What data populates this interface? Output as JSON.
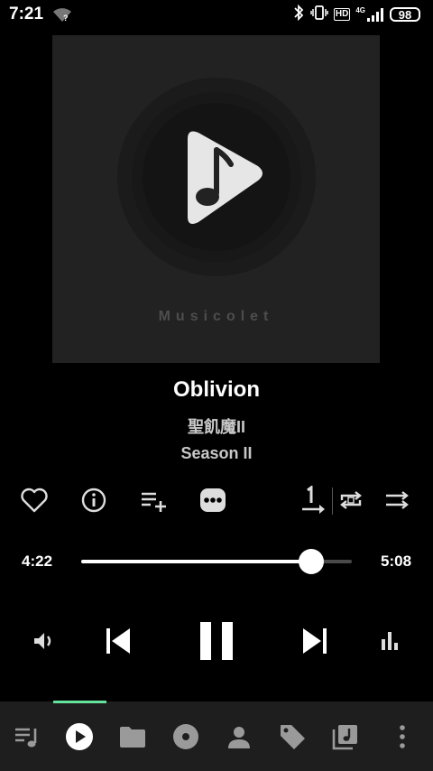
{
  "status_bar": {
    "time": "7:21",
    "wifi_icon": "wifi-question-icon",
    "bluetooth_icon": "bluetooth-icon",
    "vibrate_icon": "vibrate-icon",
    "hd_label": "HD",
    "network_label": "4G",
    "signal_icon": "signal-icon",
    "battery_level": "98"
  },
  "album_art": {
    "brand_text": "Musicolet",
    "logo_icon": "musicolet-logo-icon"
  },
  "song": {
    "title": "Oblivion",
    "artist": "聖飢魔II",
    "album": "Season II"
  },
  "actions": {
    "favorite_icon": "heart-outline-icon",
    "info_icon": "info-icon",
    "add_to_queue_icon": "playlist-add-icon",
    "more_icon": "more-horizontal-icon",
    "repeat_one_icon": "repeat-one-icon",
    "repeat_icon": "repeat-icon",
    "shuffle_icon": "shuffle-icon"
  },
  "progress": {
    "current": "4:22",
    "total": "5:08",
    "fraction": 0.85
  },
  "controls": {
    "volume_icon": "volume-icon",
    "previous_icon": "skip-previous-icon",
    "pause_icon": "pause-icon",
    "next_icon": "skip-next-icon",
    "equalizer_icon": "equalizer-icon"
  },
  "bottom_nav": {
    "items": [
      "queue-icon",
      "now-playing-icon",
      "folders-icon",
      "albums-icon",
      "artists-icon",
      "genres-icon",
      "playlists-icon",
      "overflow-menu-icon"
    ],
    "active_index": 1,
    "accent_color": "#66e39a"
  }
}
